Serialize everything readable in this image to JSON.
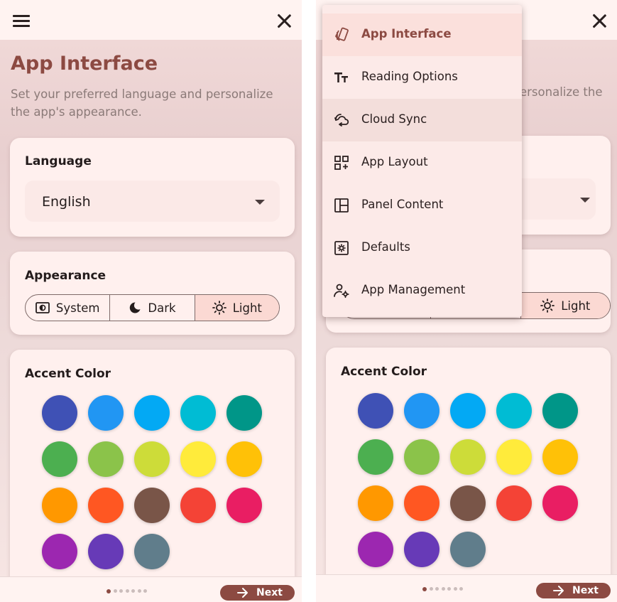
{
  "header": {
    "menu_icon": "hamburger-icon",
    "close_icon": "close-icon"
  },
  "page": {
    "title": "App Interface",
    "subtitle": "Set your preferred language and personalize the app's appearance.",
    "subtitle_visible_right": "ersonalize the"
  },
  "language": {
    "label": "Language",
    "value": "English"
  },
  "appearance": {
    "label": "Appearance",
    "options": [
      {
        "label": "System",
        "icon": "system-theme-icon"
      },
      {
        "label": "Dark",
        "icon": "moon-icon"
      },
      {
        "label": "Light",
        "icon": "sun-icon",
        "selected": true
      }
    ]
  },
  "accent": {
    "label": "Accent Color",
    "colors": [
      "#3f51b5",
      "#2196f3",
      "#03a9f4",
      "#00bcd4",
      "#009688",
      "#4caf50",
      "#8bc34a",
      "#cddc39",
      "#ffeb3b",
      "#ffc107",
      "#ff9800",
      "#ff5722",
      "#795548",
      "#f44336",
      "#e91e63",
      "#9c27b0",
      "#673ab7",
      "#607d8b"
    ]
  },
  "footer": {
    "page_count": 7,
    "active_page": 1,
    "next_label": "Next"
  },
  "menu": {
    "items": [
      {
        "label": "App Interface",
        "icon": "app-interface-icon",
        "active": true
      },
      {
        "label": "Reading Options",
        "icon": "text-size-icon"
      },
      {
        "label": "Cloud Sync",
        "icon": "cloud-sync-icon",
        "hovered": true
      },
      {
        "label": "App Layout",
        "icon": "app-layout-icon"
      },
      {
        "label": "Panel Content",
        "icon": "panel-content-icon"
      },
      {
        "label": "Defaults",
        "icon": "defaults-icon"
      },
      {
        "label": "App Management",
        "icon": "app-management-icon"
      }
    ]
  },
  "colors": {
    "brand": "#8c4a42",
    "card": "#fff0ee",
    "selected_segment": "#fbd9d3"
  }
}
